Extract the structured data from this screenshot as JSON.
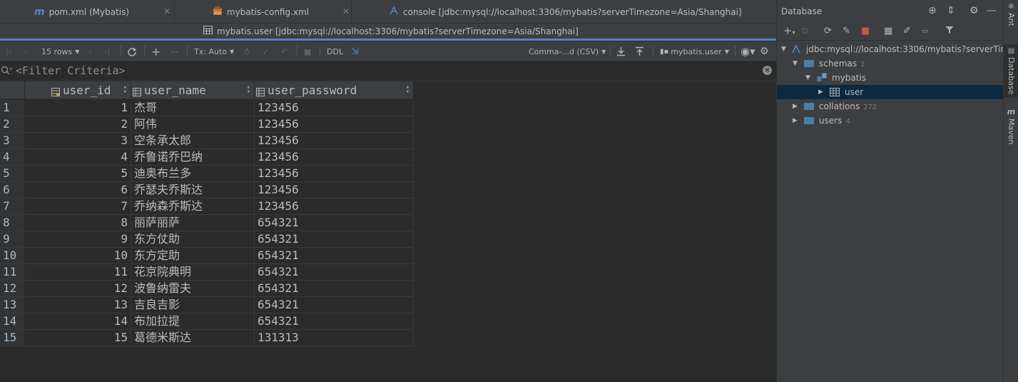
{
  "tabs_top": [
    {
      "label": "pom.xml (Mybatis)",
      "icon": "maven-m-icon"
    },
    {
      "label": "mybatis-config.xml",
      "icon": "xml-file-icon"
    },
    {
      "label": "console [jdbc:mysql://localhost:3306/mybatis?serverTimezone=Asia/Shanghai]",
      "icon": "console-icon"
    }
  ],
  "tab_active": {
    "label": "mybatis.user [jdbc:mysql://localhost:3306/mybatis?serverTimezone=Asia/Shanghai]",
    "icon": "table-icon"
  },
  "toolbar": {
    "rows_label": "15 rows",
    "tx_label": "Tx: Auto",
    "ddl_label": "DDL",
    "export_format": "Comma-...d (CSV)",
    "schema_selector": "mybatis.user"
  },
  "filter": {
    "placeholder": "<Filter Criteria>"
  },
  "grid": {
    "columns": [
      "user_id",
      "user_name",
      "user_password"
    ],
    "rows": [
      {
        "n": "1",
        "id": "1",
        "name": "杰哥",
        "pw": "123456"
      },
      {
        "n": "2",
        "id": "2",
        "name": "阿伟",
        "pw": "123456"
      },
      {
        "n": "3",
        "id": "3",
        "name": "空条承太郎",
        "pw": "123456"
      },
      {
        "n": "4",
        "id": "4",
        "name": "乔鲁诺乔巴纳",
        "pw": "123456"
      },
      {
        "n": "5",
        "id": "5",
        "name": "迪奥布兰多",
        "pw": "123456"
      },
      {
        "n": "6",
        "id": "6",
        "name": "乔瑟夫乔斯达",
        "pw": "123456"
      },
      {
        "n": "7",
        "id": "7",
        "name": "乔纳森乔斯达",
        "pw": "123456"
      },
      {
        "n": "8",
        "id": "8",
        "name": "丽萨丽萨",
        "pw": "654321"
      },
      {
        "n": "9",
        "id": "9",
        "name": "东方仗助",
        "pw": "654321"
      },
      {
        "n": "10",
        "id": "10",
        "name": "东方定助",
        "pw": "654321"
      },
      {
        "n": "11",
        "id": "11",
        "name": "花京院典明",
        "pw": "654321"
      },
      {
        "n": "12",
        "id": "12",
        "name": "波鲁纳雷夫",
        "pw": "654321"
      },
      {
        "n": "13",
        "id": "13",
        "name": "吉良吉影",
        "pw": "654321"
      },
      {
        "n": "14",
        "id": "14",
        "name": "布加拉提",
        "pw": "654321"
      },
      {
        "n": "15",
        "id": "15",
        "name": "葛德米斯达",
        "pw": "131313"
      }
    ]
  },
  "db_panel": {
    "title": "Database",
    "tree": {
      "connection": "jdbc:mysql://localhost:3306/mybatis?serverTime",
      "schemas": {
        "label": "schemas",
        "count": "1"
      },
      "mybatis": "mybatis",
      "user": "user",
      "collations": {
        "label": "collations",
        "count": "272"
      },
      "users": {
        "label": "users",
        "count": "4"
      }
    }
  },
  "side_strip": {
    "ant": "Ant",
    "database": "Database",
    "maven": "Maven"
  },
  "colors": {
    "background": "#2b2b2b",
    "panel": "#3c3f41",
    "accent_blue": "#4a88c7",
    "selection": "#0d293e",
    "stop_red": "#c75450"
  }
}
